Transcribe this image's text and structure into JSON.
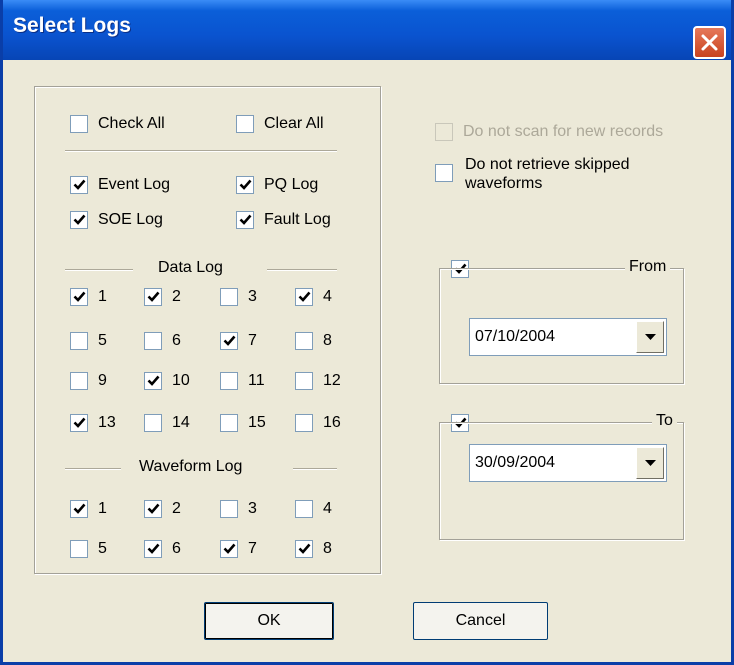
{
  "window": {
    "title": "Select Logs"
  },
  "options": {
    "check_all": {
      "label": "Check All",
      "checked": false
    },
    "clear_all": {
      "label": "Clear All",
      "checked": false
    },
    "event_log": {
      "label": "Event Log",
      "checked": true
    },
    "pq_log": {
      "label": "PQ Log",
      "checked": true
    },
    "soe_log": {
      "label": "SOE Log",
      "checked": true
    },
    "fault_log": {
      "label": "Fault Log",
      "checked": true
    }
  },
  "data_log": {
    "title": "Data Log",
    "items": [
      {
        "label": "1",
        "checked": true
      },
      {
        "label": "2",
        "checked": true
      },
      {
        "label": "3",
        "checked": false
      },
      {
        "label": "4",
        "checked": true
      },
      {
        "label": "5",
        "checked": false
      },
      {
        "label": "6",
        "checked": false
      },
      {
        "label": "7",
        "checked": true
      },
      {
        "label": "8",
        "checked": false
      },
      {
        "label": "9",
        "checked": false
      },
      {
        "label": "10",
        "checked": true
      },
      {
        "label": "11",
        "checked": false
      },
      {
        "label": "12",
        "checked": false
      },
      {
        "label": "13",
        "checked": true
      },
      {
        "label": "14",
        "checked": false
      },
      {
        "label": "15",
        "checked": false
      },
      {
        "label": "16",
        "checked": false
      }
    ]
  },
  "waveform_log": {
    "title": "Waveform Log",
    "items": [
      {
        "label": "1",
        "checked": true
      },
      {
        "label": "2",
        "checked": true
      },
      {
        "label": "3",
        "checked": false
      },
      {
        "label": "4",
        "checked": false
      },
      {
        "label": "5",
        "checked": false
      },
      {
        "label": "6",
        "checked": true
      },
      {
        "label": "7",
        "checked": true
      },
      {
        "label": "8",
        "checked": true
      }
    ]
  },
  "scan": {
    "no_new_records": {
      "label": "Do not scan for new records",
      "checked": false,
      "disabled": true
    },
    "no_skipped_waveforms": {
      "label_line1": "Do not retrieve skipped",
      "label_line2": "waveforms",
      "checked": false
    }
  },
  "from": {
    "label": "From",
    "enabled": true,
    "date": "07/10/2004"
  },
  "to": {
    "label": "To",
    "enabled": true,
    "date": "30/09/2004"
  },
  "buttons": {
    "ok": "OK",
    "cancel": "Cancel"
  }
}
